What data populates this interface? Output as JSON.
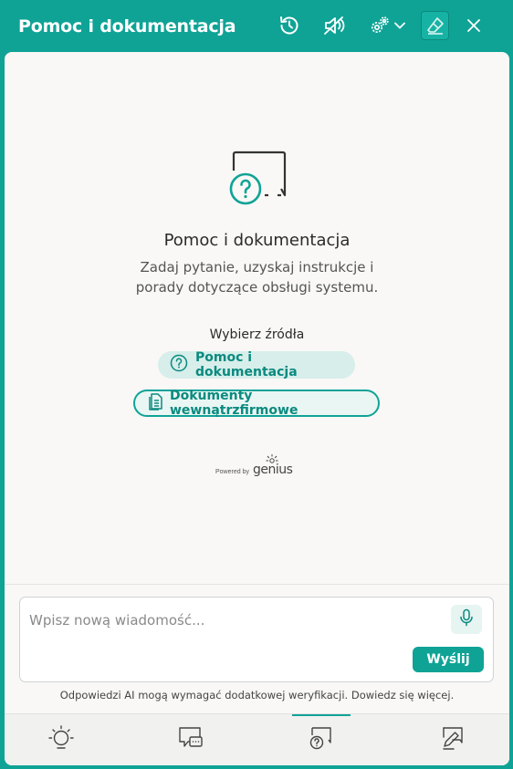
{
  "window": {
    "title": "Pomoc i dokumentacja"
  },
  "toolbar": {
    "icons": [
      "history-icon",
      "mute-icon",
      "settings-icon",
      "chevron-down-icon",
      "eraser-icon",
      "close-icon"
    ]
  },
  "hero": {
    "icon": "help-chat-icon",
    "title": "Pomoc i dokumentacja",
    "description_line1": "Zadaj pytanie, uzyskaj instrukcje i",
    "description_line2": "porady dotyczące obsługi systemu."
  },
  "sources": {
    "label": "Wybierz źródła",
    "chips": [
      {
        "label": "Pomoc i dokumentacja",
        "icon": "question-circle-icon"
      },
      {
        "label": "Dokumenty wewnątrzfirmowe",
        "icon": "document-icon"
      }
    ]
  },
  "powered_by": {
    "small": "Powered by",
    "brand": "genius"
  },
  "composer": {
    "placeholder": "Wpisz nową wiadomość...",
    "value": "",
    "send_label": "Wyślij"
  },
  "disclaimer": "Odpowiedzi AI mogą wymagać dodatkowej weryfikacji. Dowiedz się więcej.",
  "bottom_nav": {
    "items": [
      {
        "icon": "lightbulb-icon"
      },
      {
        "icon": "chat-icon"
      },
      {
        "icon": "help-chat-icon",
        "active": true
      },
      {
        "icon": "edit-chat-icon"
      }
    ]
  },
  "colors": {
    "accent": "#0fa396",
    "panel_bg": "#f9f8f6"
  }
}
